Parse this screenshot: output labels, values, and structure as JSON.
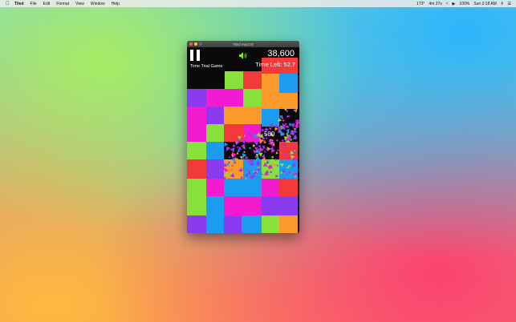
{
  "menubar": {
    "app_name": "Tiled",
    "menus": [
      "File",
      "Edit",
      "Format",
      "View",
      "Window",
      "Help"
    ],
    "status": {
      "temperature": "173°",
      "timer": "4m 27s",
      "battery": "100%",
      "clock": "Sun 2:18 AM"
    }
  },
  "window": {
    "title": "Tiled macOS"
  },
  "game": {
    "score": "38,600",
    "time_left": "Time Left: 52.7",
    "mode": "Time Trial Game",
    "points_popup": "500",
    "colors": {
      "purple": "#8a3bf0",
      "magenta": "#f21bcf",
      "lime": "#88e03a",
      "orange": "#fb9a2a",
      "red": "#f23a3a",
      "blue": "#1a9cf0",
      "black": "#0a0a0a"
    }
  }
}
